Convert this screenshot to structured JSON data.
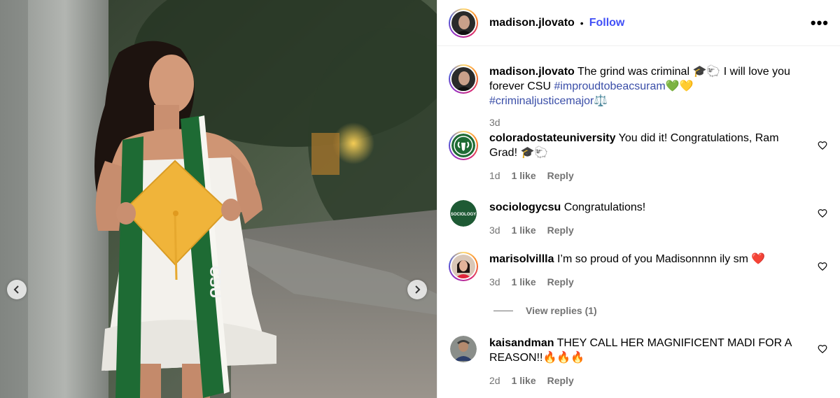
{
  "post": {
    "username": "madison.jlovato",
    "follow_label": "Follow",
    "separator": "•",
    "more_label": "•••"
  },
  "caption": {
    "username": "madison.jlovato",
    "text": " The grind was criminal 🎓🐑 I will love you forever CSU ",
    "hashtag1": "#improudtobeacsuram",
    "emoji": "💚💛",
    "hashtag2": "#criminaljusticemajor",
    "hashtag2_emoji": "⚖️",
    "time": "3d"
  },
  "comments": [
    {
      "username": "coloradostateuniversity",
      "text": " You did it! Congratulations, Ram Grad! 🎓🐑",
      "time": "1d",
      "likes": "1 like",
      "reply": "Reply"
    },
    {
      "username": "sociologycsu",
      "text": " Congratulations!",
      "time": "3d",
      "likes": "1 like",
      "reply": "Reply",
      "avatar_text": "SOCIOLOGY"
    },
    {
      "username": "marisolvillla",
      "text": " I’m so proud of you Madisonnnn ily sm ❤️",
      "time": "3d",
      "likes": "1 like",
      "reply": "Reply"
    },
    {
      "username": "kaisandman",
      "text": " THEY CALL HER MAGNIFICENT MADI FOR A REASON!!🔥🔥🔥",
      "time": "2d",
      "likes": "1 like",
      "reply": "Reply"
    }
  ],
  "view_replies": "View replies (1)",
  "colors": {
    "link": "#4150f7",
    "hashtag": "#3a4ea8",
    "meta": "#737373",
    "csu_green": "#1e6b34"
  },
  "icons": {
    "prev": "chevron-left-icon",
    "next": "chevron-right-icon",
    "like": "heart-outline-icon"
  }
}
